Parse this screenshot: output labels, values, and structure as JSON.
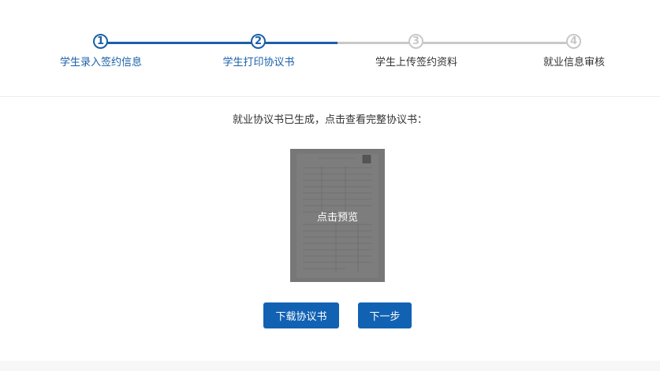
{
  "steps": [
    {
      "number": "1",
      "label": "学生录入签约信息",
      "state": "active"
    },
    {
      "number": "2",
      "label": "学生打印协议书",
      "state": "active"
    },
    {
      "number": "3",
      "label": "学生上传签约资料",
      "state": "inactive"
    },
    {
      "number": "4",
      "label": "就业信息审核",
      "state": "inactive"
    }
  ],
  "content": {
    "hint": "就业协议书已生成，点击查看完整协议书：",
    "preview_label": "点击预览"
  },
  "buttons": {
    "download_label": "下载协议书",
    "next_label": "下一步"
  },
  "colors": {
    "accent": "#1a5fa8",
    "button": "#1262b3",
    "inactive": "#c8c8c8"
  }
}
